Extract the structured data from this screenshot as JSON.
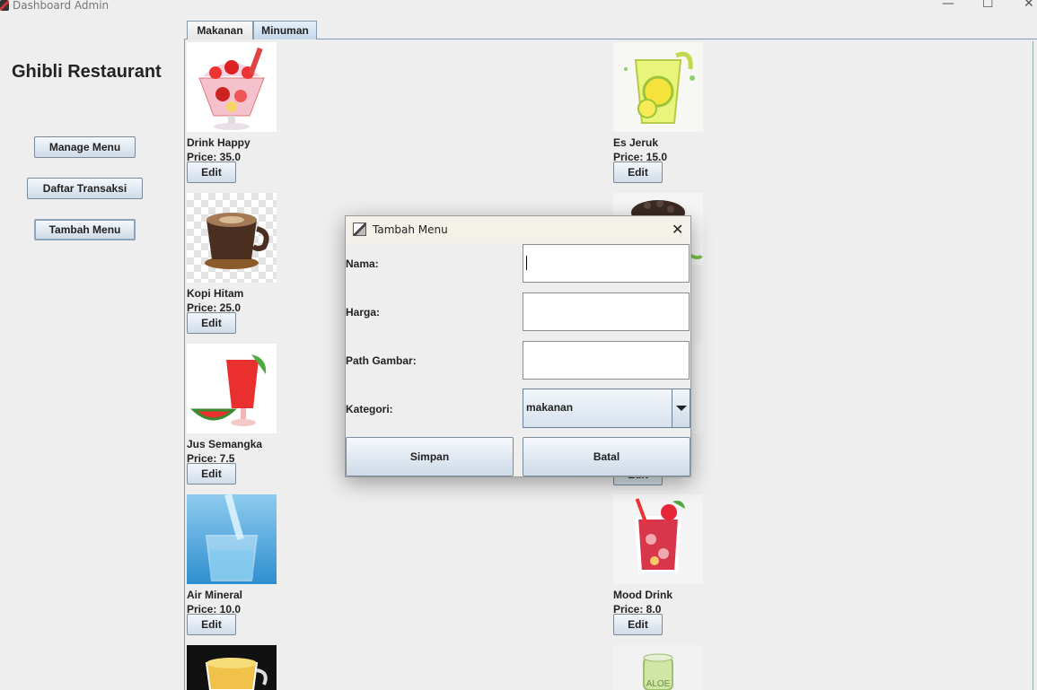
{
  "window": {
    "title": "Dashboard Admin",
    "minimize": "—",
    "maximize": "☐",
    "close": "✕"
  },
  "sidebar": {
    "brand": "Ghibli Restaurant",
    "buttons": [
      "Manage Menu",
      "Daftar Transaksi",
      "Tambah Menu"
    ]
  },
  "tabs": [
    {
      "label": "Makanan"
    },
    {
      "label": "Minuman"
    }
  ],
  "active_tab": "Minuman",
  "menu_items": [
    {
      "name": "Drink Happy",
      "price": "Price: 35.0",
      "edit": "Edit",
      "icon": "parfait-image"
    },
    {
      "name": "Es Jeruk",
      "price": "Price: 15.0",
      "edit": "Edit",
      "icon": "orange-juice-image"
    },
    {
      "name": "Kopi Hitam",
      "price": "Price: 25.0",
      "edit": "Edit",
      "icon": "coffee-cup-image"
    },
    {
      "name": "Jus Semangka",
      "price": "Price: 7.5",
      "edit": "Edit",
      "icon": "watermelon-juice-image"
    },
    {
      "name": "Air Mineral",
      "price": "Price: 10.0",
      "edit": "Edit",
      "icon": "water-glass-image"
    },
    {
      "name": "Mood Drink",
      "price": "Price: 8.0",
      "edit": "Edit",
      "icon": "fruit-drink-image"
    }
  ],
  "partial_images": {
    "right_under_dialog": "Edit",
    "can_label": "ALOE"
  },
  "dialog": {
    "title": "Tambah Menu",
    "close": "✕",
    "fields": [
      {
        "label": "Nama:",
        "value": ""
      },
      {
        "label": "Harga:",
        "value": ""
      },
      {
        "label": "Path Gambar:",
        "value": ""
      }
    ],
    "kategori": {
      "label": "Kategori:",
      "selected": "makanan"
    },
    "buttons": {
      "save": "Simpan",
      "cancel": "Batal"
    }
  }
}
